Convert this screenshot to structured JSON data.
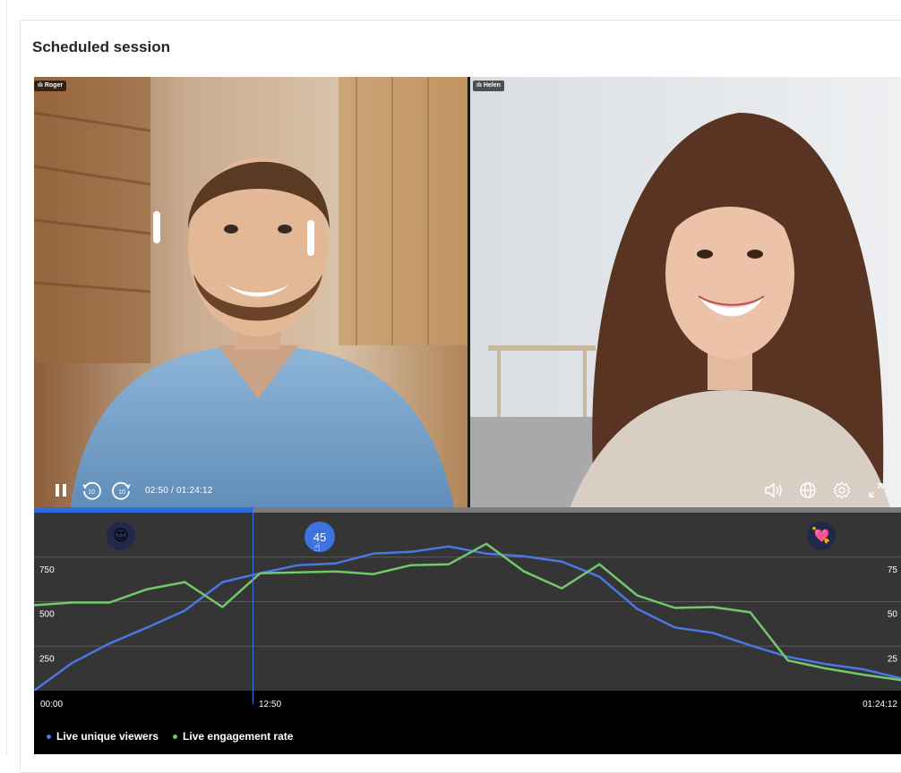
{
  "page": {
    "title": "Scheduled session"
  },
  "participants": [
    {
      "name": "Roger"
    },
    {
      "name": "Helen"
    }
  ],
  "player": {
    "time_display": "02:50 / 01:24:12",
    "progress_fraction": 0.252,
    "icons": {
      "pause": "pause-icon",
      "rewind": "rewind-10-icon",
      "forward": "forward-10-icon",
      "volume": "volume-icon",
      "language": "globe-icon",
      "settings": "gear-icon",
      "fullscreen": "fullscreen-icon"
    },
    "rewind_label": "10",
    "forward_label": "10"
  },
  "timeline": {
    "start_label": "00:00",
    "cursor_label": "12:50",
    "end_label": "01:24:12",
    "marker_value": "45",
    "reactions": [
      "😍",
      "💘"
    ]
  },
  "chart_data": {
    "type": "line",
    "x": [
      0,
      1,
      2,
      3,
      4,
      5,
      6,
      7,
      8,
      9,
      10,
      11,
      12,
      13,
      14,
      15,
      16,
      17,
      18,
      19,
      20,
      21,
      22,
      23
    ],
    "series": [
      {
        "name": "Live unique viewers",
        "color": "#4a78e3",
        "values": [
          0,
          155,
          265,
          355,
          450,
          610,
          660,
          705,
          715,
          770,
          780,
          810,
          770,
          755,
          725,
          640,
          460,
          355,
          325,
          255,
          190,
          150,
          120,
          70
        ]
      },
      {
        "name": "Live engagement rate",
        "color": "#72c86a",
        "values": [
          480,
          495,
          495,
          570,
          610,
          470,
          660,
          665,
          670,
          655,
          705,
          710,
          825,
          670,
          575,
          710,
          535,
          465,
          470,
          440,
          170,
          125,
          90,
          60
        ]
      }
    ],
    "y_ticks_left": [
      "750",
      "500",
      "250"
    ],
    "y_ticks_right": [
      "75",
      "50",
      "25"
    ],
    "ylim": [
      0,
      1000
    ],
    "grid": true
  }
}
